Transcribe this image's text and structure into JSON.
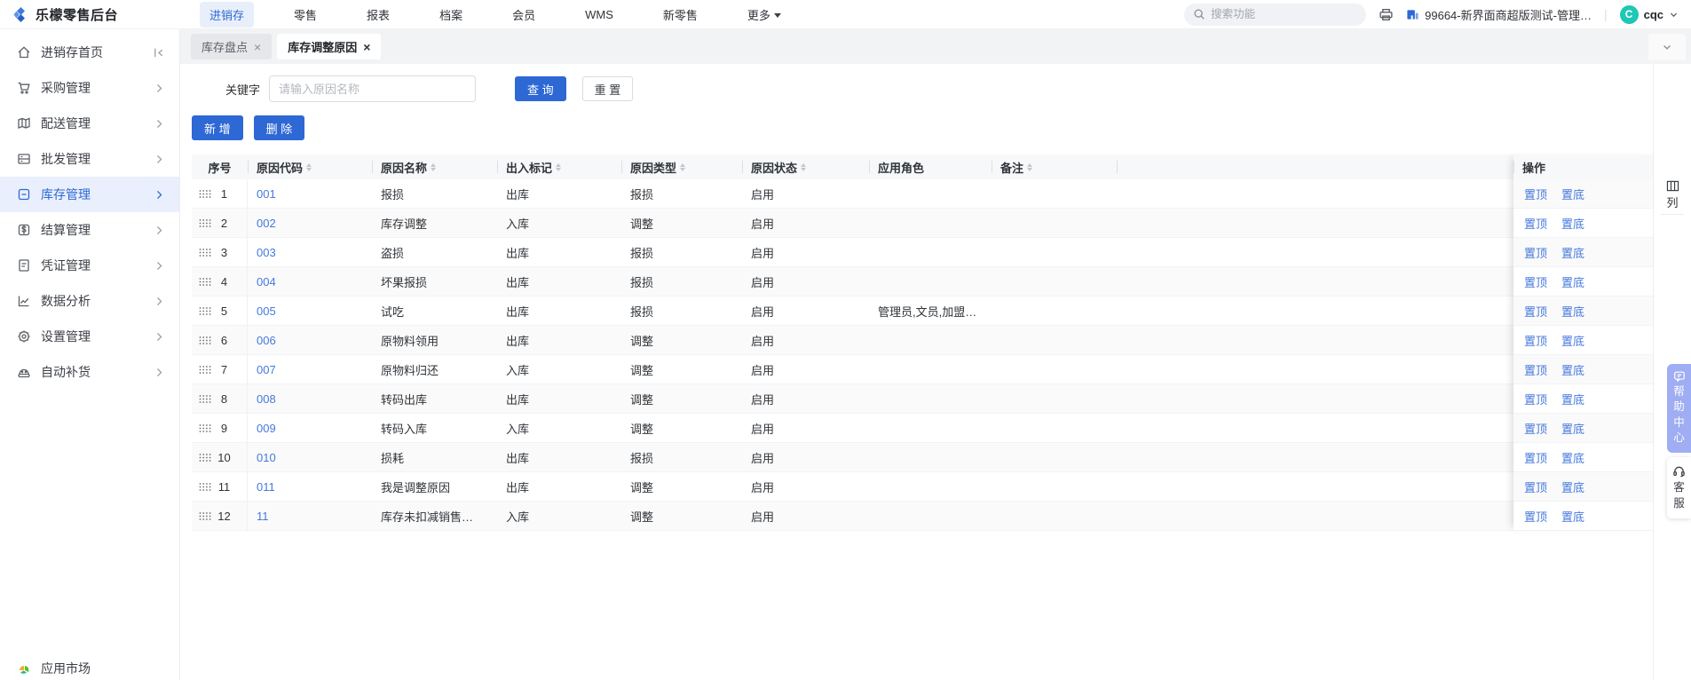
{
  "topbar": {
    "logo_text": "乐檬零售后台",
    "nav": [
      {
        "label": "进销存",
        "active": true
      },
      {
        "label": "零售"
      },
      {
        "label": "报表"
      },
      {
        "label": "档案"
      },
      {
        "label": "会员"
      },
      {
        "label": "WMS"
      },
      {
        "label": "新零售"
      },
      {
        "label": "更多",
        "caret": true
      }
    ],
    "search_placeholder": "搜索功能",
    "org_name": "99664-新界面商超版测试-管理…",
    "separator": "|",
    "user": {
      "avatar_letter": "C",
      "name": "cqc"
    }
  },
  "sidebar": {
    "items": [
      {
        "label": "进销存首页",
        "icon": "home-icon",
        "right": "collapse"
      },
      {
        "label": "采购管理",
        "icon": "cart-icon",
        "right": "chevron"
      },
      {
        "label": "配送管理",
        "icon": "map-icon",
        "right": "chevron"
      },
      {
        "label": "批发管理",
        "icon": "boxes-icon",
        "right": "chevron"
      },
      {
        "label": "库存管理",
        "icon": "inventory-icon",
        "right": "chevron",
        "active": true
      },
      {
        "label": "结算管理",
        "icon": "dollar-icon",
        "right": "chevron"
      },
      {
        "label": "凭证管理",
        "icon": "document-icon",
        "right": "chevron"
      },
      {
        "label": "数据分析",
        "icon": "chart-icon",
        "right": "chevron"
      },
      {
        "label": "设置管理",
        "icon": "gear-icon",
        "right": "chevron"
      },
      {
        "label": "自动补货",
        "icon": "robot-icon",
        "right": "chevron"
      }
    ],
    "bottom_item": {
      "label": "应用市场",
      "icon": "app-market-icon"
    }
  },
  "tabs": [
    {
      "label": "库存盘点",
      "close": "×"
    },
    {
      "label": "库存调整原因",
      "close": "×",
      "active": true
    }
  ],
  "filter": {
    "keyword_label": "关键字",
    "keyword_value": "",
    "keyword_placeholder": "请输入原因名称",
    "search_button": "查 询",
    "reset_button": "重 置"
  },
  "toolbar": {
    "add_button": "新 增",
    "delete_button": "删 除"
  },
  "table": {
    "columns": [
      {
        "label": "序号",
        "sortable": false
      },
      {
        "label": "原因代码",
        "sortable": true
      },
      {
        "label": "原因名称",
        "sortable": true
      },
      {
        "label": "出入标记",
        "sortable": true
      },
      {
        "label": "原因类型",
        "sortable": true
      },
      {
        "label": "原因状态",
        "sortable": true
      },
      {
        "label": "应用角色",
        "sortable": false
      },
      {
        "label": "备注",
        "sortable": true
      }
    ],
    "action_column": {
      "label": "操作",
      "actions": [
        "置顶",
        "置底"
      ]
    },
    "column_tool_label": "列",
    "rows": [
      {
        "no": "1",
        "code": "001",
        "name": "报损",
        "flag": "出库",
        "type": "报损",
        "status": "启用",
        "roles": "",
        "remark": ""
      },
      {
        "no": "2",
        "code": "002",
        "name": "库存调整",
        "flag": "入库",
        "type": "调整",
        "status": "启用",
        "roles": "",
        "remark": ""
      },
      {
        "no": "3",
        "code": "003",
        "name": "盗损",
        "flag": "出库",
        "type": "报损",
        "status": "启用",
        "roles": "",
        "remark": ""
      },
      {
        "no": "4",
        "code": "004",
        "name": "坏果报损",
        "flag": "出库",
        "type": "报损",
        "status": "启用",
        "roles": "",
        "remark": ""
      },
      {
        "no": "5",
        "code": "005",
        "name": "试吃",
        "flag": "出库",
        "type": "报损",
        "status": "启用",
        "roles": "管理员,文员,加盟…",
        "remark": ""
      },
      {
        "no": "6",
        "code": "006",
        "name": "原物料领用",
        "flag": "出库",
        "type": "调整",
        "status": "启用",
        "roles": "",
        "remark": ""
      },
      {
        "no": "7",
        "code": "007",
        "name": "原物料归还",
        "flag": "入库",
        "type": "调整",
        "status": "启用",
        "roles": "",
        "remark": ""
      },
      {
        "no": "8",
        "code": "008",
        "name": "转码出库",
        "flag": "出库",
        "type": "调整",
        "status": "启用",
        "roles": "",
        "remark": ""
      },
      {
        "no": "9",
        "code": "009",
        "name": "转码入库",
        "flag": "入库",
        "type": "调整",
        "status": "启用",
        "roles": "",
        "remark": ""
      },
      {
        "no": "10",
        "code": "010",
        "name": "损耗",
        "flag": "出库",
        "type": "报损",
        "status": "启用",
        "roles": "",
        "remark": ""
      },
      {
        "no": "11",
        "code": "011",
        "name": "我是调整原因",
        "flag": "出库",
        "type": "调整",
        "status": "启用",
        "roles": "",
        "remark": ""
      },
      {
        "no": "12",
        "code": "11",
        "name": "库存未扣减销售…",
        "flag": "入库",
        "type": "调整",
        "status": "启用",
        "roles": "",
        "remark": ""
      }
    ]
  },
  "side_widgets": {
    "help_label": "帮助中心",
    "service_label": "客服"
  },
  "colors": {
    "primary_blue": "#2e68d5",
    "nav_active_bg": "#e8effb",
    "link_blue": "#4678dd",
    "avatar_teal": "#1fc7b5",
    "help_widget_bg": "#9fadf2",
    "table_header_bg": "#f7f8fa",
    "zebra_row_bg": "#fafafa"
  }
}
